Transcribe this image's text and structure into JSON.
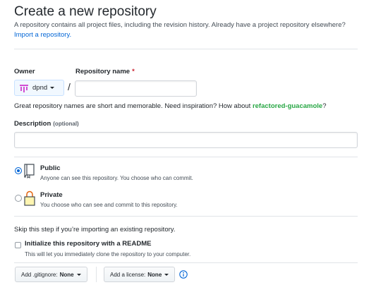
{
  "header": {
    "title": "Create a new repository",
    "description": "A repository contains all project files, including the revision history. Already have a project repository elsewhere?",
    "import_link": "Import a repository."
  },
  "owner": {
    "label": "Owner",
    "selected": "dpnd"
  },
  "repo_name": {
    "label": "Repository name",
    "required_marker": "*",
    "value": "",
    "separator": "/"
  },
  "name_help": {
    "text": "Great repository names are short and memorable. Need inspiration? How about",
    "suggestion": "refactored-guacamole",
    "suffix": "?"
  },
  "description_field": {
    "label": "Description",
    "optional": "(optional)",
    "value": ""
  },
  "visibility": {
    "public": {
      "title": "Public",
      "note": "Anyone can see this repository. You choose who can commit.",
      "selected": true
    },
    "private": {
      "title": "Private",
      "note": "You choose who can see and commit to this repository.",
      "selected": false
    }
  },
  "init": {
    "skip_text": "Skip this step if you’re importing an existing repository.",
    "readme_label": "Initialize this repository with a README",
    "readme_note": "This will let you immediately clone the repository to your computer.",
    "checked": false
  },
  "footer": {
    "gitignore_label": "Add .gitignore:",
    "gitignore_value": "None",
    "license_label": "Add a license:",
    "license_value": "None"
  },
  "colors": {
    "link": "#0366d6",
    "suggestion": "#28a745",
    "required": "#cb2431",
    "owner_avatar": "#d24dd3"
  },
  "icons": [
    "repo-icon",
    "lock-icon",
    "info-icon",
    "caret-down-icon"
  ]
}
